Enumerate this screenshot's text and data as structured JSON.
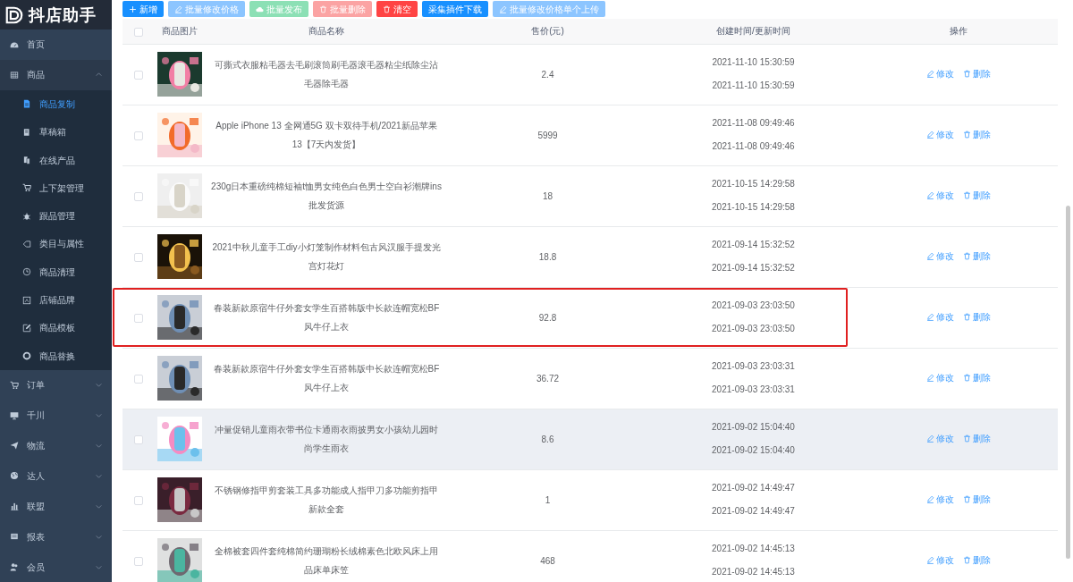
{
  "logo": {
    "title": "抖店助手"
  },
  "sidebar": {
    "items": [
      {
        "label": "首页",
        "kind": "link"
      },
      {
        "label": "商品",
        "kind": "group",
        "expanded": true,
        "children": [
          {
            "label": "商品复制",
            "selected": true
          },
          {
            "label": "草稿箱",
            "selected": false
          },
          {
            "label": "在线产品",
            "selected": false
          },
          {
            "label": "上下架管理",
            "selected": false
          },
          {
            "label": "跟品管理",
            "selected": false
          },
          {
            "label": "类目与属性",
            "selected": false
          },
          {
            "label": "商品清理",
            "selected": false
          },
          {
            "label": "店铺品牌",
            "selected": false
          },
          {
            "label": "商品模板",
            "selected": false
          },
          {
            "label": "商品替换",
            "selected": false
          }
        ]
      },
      {
        "label": "订单",
        "kind": "group",
        "expanded": false
      },
      {
        "label": "千川",
        "kind": "group",
        "expanded": false
      },
      {
        "label": "物流",
        "kind": "group",
        "expanded": false
      },
      {
        "label": "达人",
        "kind": "group",
        "expanded": false
      },
      {
        "label": "联盟",
        "kind": "group",
        "expanded": false
      },
      {
        "label": "报表",
        "kind": "group",
        "expanded": false
      },
      {
        "label": "会员",
        "kind": "group",
        "expanded": false
      }
    ]
  },
  "toolbar": [
    {
      "label": "新增",
      "kind": "add",
      "disabled": false
    },
    {
      "label": "批量修改价格",
      "kind": "edit",
      "disabled": true
    },
    {
      "label": "批量发布",
      "kind": "publish",
      "disabled": true
    },
    {
      "label": "批量删除",
      "kind": "delete",
      "disabled": true
    },
    {
      "label": "清空",
      "kind": "delete",
      "disabled": false
    },
    {
      "label": "采集插件下载",
      "kind": "download",
      "disabled": false
    },
    {
      "label": "批量修改价格单个上传",
      "kind": "edit",
      "disabled": true
    }
  ],
  "table": {
    "header_checked": false,
    "columns": [
      "商品图片",
      "商品名称",
      "售价(元)",
      "创建时间/更新时间",
      "操作"
    ],
    "rows": [
      {
        "checked": false,
        "hovered": false,
        "highlighted": false,
        "name": "可撕式衣服粘毛器去毛刷滚筒刷毛器滚毛器粘尘纸除尘沾毛器除毛器",
        "price": "2.4",
        "created": "2021-11-10 15:30:59",
        "updated": "2021-11-10 15:30:59",
        "actions": [
          "修改",
          "删除"
        ]
      },
      {
        "checked": false,
        "hovered": false,
        "highlighted": false,
        "name": "Apple iPhone 13 全网通5G 双卡双待手机/2021新品苹果13【7天内发货】",
        "price": "5999",
        "created": "2021-11-08 09:49:46",
        "updated": "2021-11-08 09:49:46",
        "actions": [
          "修改",
          "删除"
        ]
      },
      {
        "checked": false,
        "hovered": false,
        "highlighted": false,
        "name": "230g日本重磅纯棉短袖t恤男女纯色白色男士空白衫潮牌ins批发货源",
        "price": "18",
        "created": "2021-10-15 14:29:58",
        "updated": "2021-10-15 14:29:58",
        "actions": [
          "修改",
          "删除"
        ]
      },
      {
        "checked": false,
        "hovered": false,
        "highlighted": false,
        "name": "2021中秋儿童手工diy小灯笼制作材料包古风汉服手提发光宫灯花灯",
        "price": "18.8",
        "created": "2021-09-14 15:32:52",
        "updated": "2021-09-14 15:32:52",
        "actions": [
          "修改",
          "删除"
        ]
      },
      {
        "checked": false,
        "hovered": false,
        "highlighted": true,
        "name": "春装新款原宿牛仔外套女学生百搭韩版中长款连帽宽松BF风牛仔上衣",
        "price": "92.8",
        "created": "2021-09-03 23:03:50",
        "updated": "2021-09-03 23:03:50",
        "actions": [
          "修改",
          "删除"
        ]
      },
      {
        "checked": false,
        "hovered": false,
        "highlighted": false,
        "name": "春装新款原宿牛仔外套女学生百搭韩版中长款连帽宽松BF风牛仔上衣",
        "price": "36.72",
        "created": "2021-09-03 23:03:31",
        "updated": "2021-09-03 23:03:31",
        "actions": [
          "修改",
          "删除"
        ]
      },
      {
        "checked": false,
        "hovered": true,
        "highlighted": false,
        "name": "冲量促销儿童雨衣带书位卡通雨衣雨披男女小孩幼儿园时尚学生雨衣",
        "price": "8.6",
        "created": "2021-09-02 15:04:40",
        "updated": "2021-09-02 15:04:40",
        "actions": [
          "修改",
          "删除"
        ]
      },
      {
        "checked": false,
        "hovered": false,
        "highlighted": false,
        "name": "不锈钢修指甲剪套装工具多功能成人指甲刀多功能剪指甲新款全套",
        "price": "1",
        "created": "2021-09-02 14:49:47",
        "updated": "2021-09-02 14:49:47",
        "actions": [
          "修改",
          "删除"
        ]
      },
      {
        "checked": false,
        "hovered": false,
        "highlighted": false,
        "name": "全棉被套四件套纯棉简约珊瑚粉长绒棉素色北欧风床上用品床单床笠",
        "price": "468",
        "created": "2021-09-02 14:45:13",
        "updated": "2021-09-02 14:45:13",
        "actions": [
          "修改",
          "删除"
        ]
      }
    ]
  }
}
